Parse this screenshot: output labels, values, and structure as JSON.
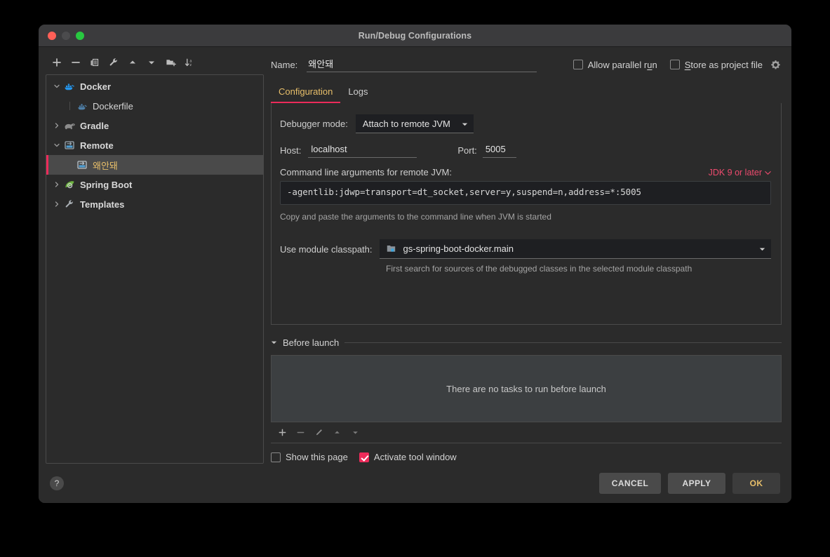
{
  "window": {
    "title": "Run/Debug Configurations",
    "traffic_lights": [
      "close",
      "minimize",
      "zoom"
    ]
  },
  "tree_toolbar": {
    "buttons": [
      {
        "name": "add-configuration",
        "icon": "plus-icon"
      },
      {
        "name": "remove-configuration",
        "icon": "minus-icon"
      },
      {
        "name": "copy-configuration",
        "icon": "copy-icon"
      },
      {
        "name": "edit-templates",
        "icon": "wrench-icon"
      },
      {
        "name": "move-up",
        "icon": "arrow-up-icon"
      },
      {
        "name": "move-down",
        "icon": "arrow-down-icon"
      },
      {
        "name": "new-folder",
        "icon": "new-folder-icon"
      },
      {
        "name": "sort-alphabetically",
        "icon": "sort-az-icon"
      }
    ]
  },
  "tree": {
    "items": [
      {
        "label": "Docker",
        "icon": "docker-icon",
        "level": 0,
        "expanded": true,
        "group": true,
        "selected": false
      },
      {
        "label": "Dockerfile",
        "icon": "docker-icon",
        "level": 1,
        "expanded": null,
        "group": false,
        "selected": false
      },
      {
        "label": "Gradle",
        "icon": "gradle-icon",
        "level": 0,
        "expanded": false,
        "group": true,
        "selected": false
      },
      {
        "label": "Remote",
        "icon": "remote-icon",
        "level": 0,
        "expanded": true,
        "group": true,
        "selected": false
      },
      {
        "label": "왜안돼",
        "icon": "remote-icon",
        "level": 1,
        "expanded": null,
        "group": false,
        "selected": true
      },
      {
        "label": "Spring Boot",
        "icon": "spring-icon",
        "level": 0,
        "expanded": false,
        "group": true,
        "selected": false
      },
      {
        "label": "Templates",
        "icon": "wrench-icon",
        "level": 0,
        "expanded": false,
        "group": true,
        "selected": false
      }
    ]
  },
  "header": {
    "name_label": "Name:",
    "name_value": "왜안돼",
    "allow_parallel_run": {
      "label": "Allow parallel run",
      "checked": false
    },
    "store_as_project_file": {
      "label": "Store as project file",
      "checked": false
    },
    "gear_icon": "gear-icon"
  },
  "tabs": [
    {
      "label": "Configuration",
      "active": true
    },
    {
      "label": "Logs",
      "active": false
    }
  ],
  "configuration": {
    "debugger_mode_label": "Debugger mode:",
    "debugger_mode_value": "Attach to remote JVM",
    "host_label": "Host:",
    "host_value": "localhost",
    "port_label": "Port:",
    "port_value": "5005",
    "args_label": "Command line arguments for remote JVM:",
    "jdk_selector": "JDK 9 or later",
    "args_value": "-agentlib:jdwp=transport=dt_socket,server=y,suspend=n,address=*:5005",
    "args_hint": "Copy and paste the arguments to the command line when JVM is started",
    "classpath_label": "Use module classpath:",
    "classpath_value": "gs-spring-boot-docker.main",
    "classpath_icon": "module-icon",
    "classpath_hint": "First search for sources of the debugged classes in the selected module classpath"
  },
  "before_launch": {
    "title": "Before launch",
    "empty_message": "There are no tasks to run before launch",
    "toolbar": [
      {
        "name": "add-task",
        "icon": "plus-icon"
      },
      {
        "name": "remove-task",
        "icon": "minus-icon"
      },
      {
        "name": "edit-task",
        "icon": "pencil-icon"
      },
      {
        "name": "move-task-up",
        "icon": "arrow-up-icon"
      },
      {
        "name": "move-task-down",
        "icon": "arrow-down-icon"
      }
    ],
    "show_this_page": {
      "label": "Show this page",
      "checked": false
    },
    "activate_tool_window": {
      "label": "Activate tool window",
      "checked": true
    }
  },
  "footer": {
    "help_label": "?",
    "cancel_label": "CANCEL",
    "apply_label": "APPLY",
    "ok_label": "OK"
  },
  "colors": {
    "accent_pink": "#ec2b5a",
    "accent_gold": "#e8bf6a",
    "link_pink": "#ec4a6d",
    "window_bg": "#2b2b2b",
    "field_bg": "#1e1f22"
  }
}
